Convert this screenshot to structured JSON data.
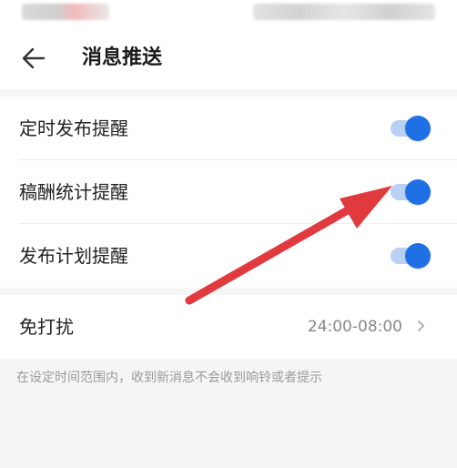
{
  "header": {
    "title": "消息推送",
    "back_icon": "back-arrow-icon"
  },
  "notifications": [
    {
      "label": "定时发布提醒",
      "enabled": true
    },
    {
      "label": "稿酬统计提醒",
      "enabled": true
    },
    {
      "label": "发布计划提醒",
      "enabled": true
    }
  ],
  "dnd": {
    "label": "免打扰",
    "value": "24:00-08:00"
  },
  "hint": "在设定时间范围内，收到新消息不会收到响铃或者提示",
  "colors": {
    "accent": "#1f6fe5",
    "track": "#b9d0f5",
    "annotation": "#e03a3f"
  }
}
